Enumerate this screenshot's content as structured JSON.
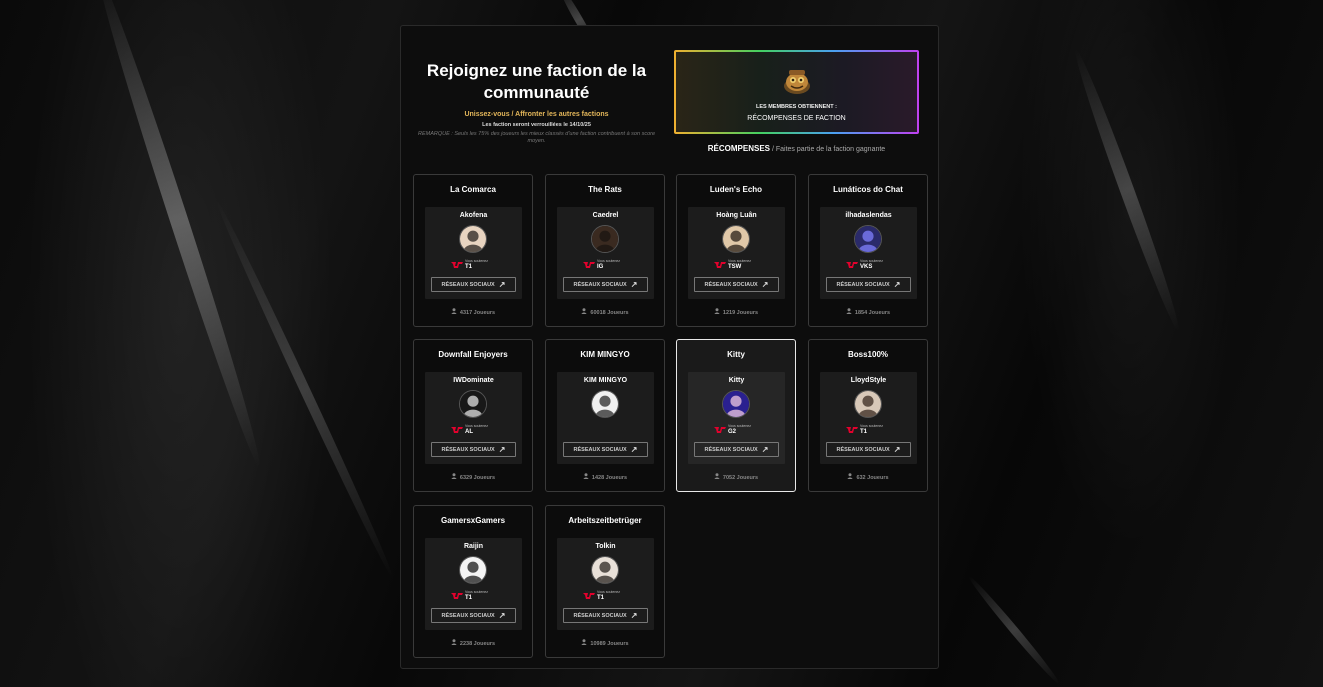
{
  "header": {
    "title": "Rejoignez une faction de la communauté",
    "subtitle": "Unissez-vous / Affronter les autres factions",
    "lock_notice": "Les faction seront verrouillées le 14/10/25",
    "remark": "REMARQUE : Seuls les 75% des joueurs les mieux classés d'une faction contribuent à son score moyen."
  },
  "rewards": {
    "label": "LES MEMBRES OBTIENNENT :",
    "value": "RÉCOMPENSES DE FACTION",
    "caption_strong": "RÉCOMPENSES",
    "caption_rest": " / Faites partie de la faction gagnante"
  },
  "labels": {
    "supports": "Vous soutenez",
    "social_button": "RÉSEAUX SOCIAUX"
  },
  "factions": [
    {
      "name": "La Comarca",
      "leader": "Akofena",
      "team": "T1",
      "players": "4317 Joueurs",
      "active": false
    },
    {
      "name": "The Rats",
      "leader": "Caedrel",
      "team": "IG",
      "players": "60018 Joueurs",
      "active": false
    },
    {
      "name": "Luden's Echo",
      "leader": "Hoàng Luân",
      "team": "TSW",
      "players": "1219 Joueurs",
      "active": false
    },
    {
      "name": "Lunáticos do Chat",
      "leader": "ilhadaslendas",
      "team": "VKS",
      "players": "1854 Joueurs",
      "active": false
    },
    {
      "name": "Downfall Enjoyers",
      "leader": "IWDominate",
      "team": "AL",
      "players": "6329 Joueurs",
      "active": false
    },
    {
      "name": "KIM MINGYO",
      "leader": "KIM MINGYO",
      "team": "",
      "players": "1428 Joueurs",
      "active": false
    },
    {
      "name": "Kitty",
      "leader": "Kitty",
      "team": "G2",
      "players": "7052 Joueurs",
      "active": true
    },
    {
      "name": "Boss100%",
      "leader": "LloydStyle",
      "team": "T1",
      "players": "632 Joueurs",
      "active": false
    },
    {
      "name": "GamersxGamers",
      "leader": "Raijin",
      "team": "T1",
      "players": "2238 Joueurs",
      "active": false
    },
    {
      "name": "Arbeitszeitbetrüger",
      "leader": "Tolkin",
      "team": "T1",
      "players": "10989 Joueurs",
      "active": false
    }
  ],
  "icons": {
    "avatar": "avatar-icon",
    "team_logo": "team-logo-icon",
    "external_link": "external-link-icon",
    "players": "user-icon",
    "reward": "reward-chest-icon"
  },
  "colors": {
    "accent_gold": "#e3b65a",
    "t1_red": "#e2012d",
    "active_border": "#e8e8e8"
  }
}
